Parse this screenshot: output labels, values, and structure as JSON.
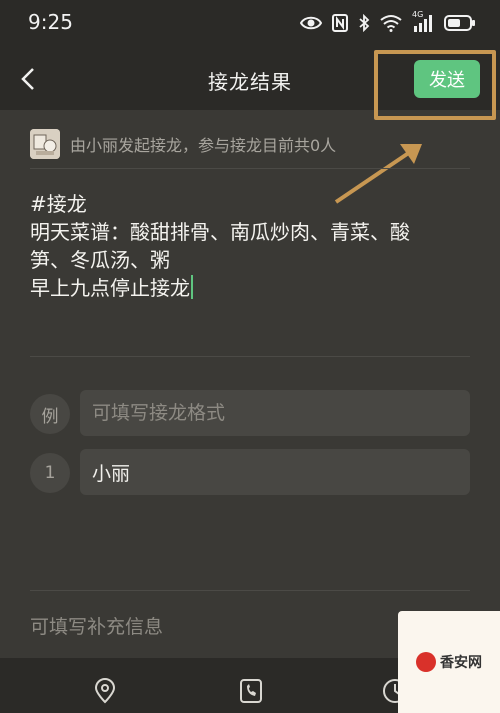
{
  "status_bar": {
    "time": "9:25",
    "icons": [
      "eye-icon",
      "nfc-icon",
      "bluetooth-icon",
      "wifi-icon",
      "signal-4g-icon",
      "battery-icon"
    ],
    "network_label": "4G"
  },
  "nav": {
    "title": "接龙结果",
    "send_label": "发送",
    "back_icon": "chevron-left-icon"
  },
  "initiator": {
    "text": "由小丽发起接龙，参与接龙目前共0人"
  },
  "content": {
    "lines": [
      "#接龙",
      "明天菜谱：酸甜排骨、南瓜炒肉、青菜、酸",
      "笋、冬瓜汤、粥",
      "早上九点停止接龙"
    ]
  },
  "entries": {
    "example_badge": "例",
    "example_placeholder": "可填写接龙格式",
    "items": [
      {
        "index": "1",
        "value": "小丽"
      }
    ]
  },
  "supplement": {
    "placeholder": "可填写补充信息"
  },
  "bottom_bar": {
    "icons": [
      "location-icon",
      "phone-icon",
      "clock-icon"
    ]
  },
  "watermark": {
    "text": "香安网"
  },
  "colors": {
    "background": "#3a3935",
    "bars": "#2b2a27",
    "accent_green": "#5fc580",
    "annotation_orange": "#c79752"
  }
}
